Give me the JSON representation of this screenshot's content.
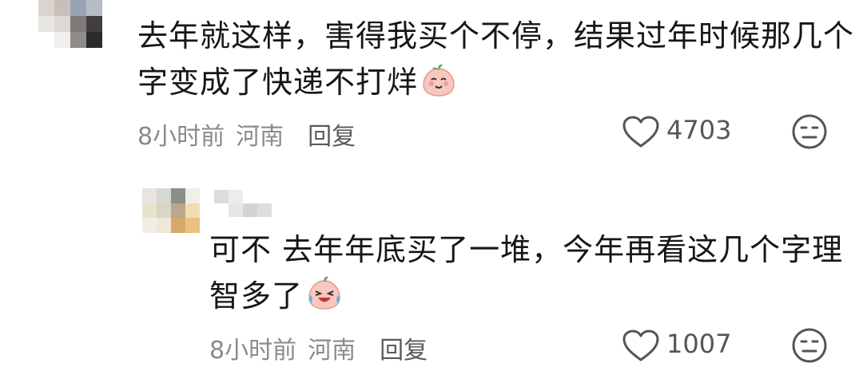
{
  "comment": {
    "text_line1": "去年就这样，害得我买个不停，结果过年时候那几个",
    "text_line2": "字变成了快递不打烊",
    "emoji": "smile-peach-emoji",
    "time": "8小时前",
    "location": "河南",
    "reply_label": "回复",
    "likes": "4703"
  },
  "reply": {
    "text_line1": "可不  去年年底买了一堆，今年再看这几个字理",
    "text_line2": "智多了",
    "emoji": "laugh-cry-peach-emoji",
    "time": "8小时前",
    "location": "河南",
    "reply_label": "回复",
    "likes": "1007"
  },
  "icons": {
    "like": "heart-outline-icon",
    "dislike": "unhappy-face-icon"
  },
  "colors": {
    "text": "#161616",
    "meta": "#8a8a8a",
    "icon": "#555555"
  }
}
